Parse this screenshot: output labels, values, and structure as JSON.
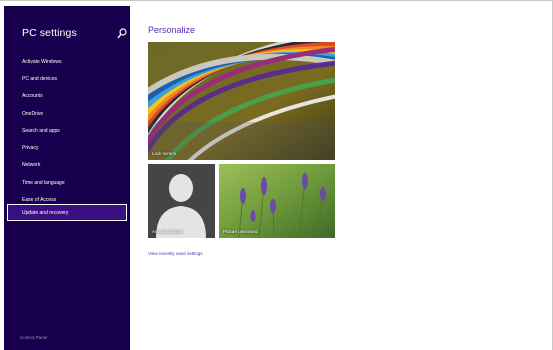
{
  "sidebar": {
    "title": "PC settings",
    "items": [
      {
        "label": "Activate Windows"
      },
      {
        "label": "PC and devices"
      },
      {
        "label": "Accounts"
      },
      {
        "label": "OneDrive"
      },
      {
        "label": "Search and apps"
      },
      {
        "label": "Privacy"
      },
      {
        "label": "Network"
      },
      {
        "label": "Time and language"
      },
      {
        "label": "Ease of Access"
      },
      {
        "label": "Update and recovery"
      }
    ],
    "control_panel": "Control Panel"
  },
  "main": {
    "title": "Personalize",
    "tiles": {
      "lock_screen": "Lock screen",
      "account_picture": "Account picture",
      "picture_password": "Picture password"
    },
    "recent_link": "View recently used settings"
  },
  "colors": {
    "sidebar_bg": "#18004e",
    "accent": "#5a2eb5",
    "selected_border": "#ffffff"
  }
}
